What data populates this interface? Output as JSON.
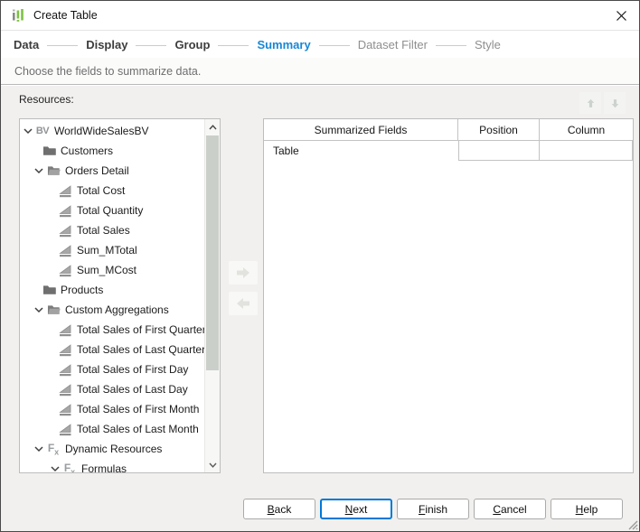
{
  "window": {
    "title": "Create Table",
    "close_glyph": "×",
    "app_icon": "bar-chart-icon"
  },
  "steps": [
    {
      "label": "Data",
      "state": "done"
    },
    {
      "label": "Display",
      "state": "done"
    },
    {
      "label": "Group",
      "state": "done"
    },
    {
      "label": "Summary",
      "state": "active"
    },
    {
      "label": "Dataset Filter",
      "state": "todo"
    },
    {
      "label": "Style",
      "state": "todo"
    }
  ],
  "instruction": "Choose the fields to summarize data.",
  "resources": {
    "label": "Resources:",
    "tree": [
      {
        "label": "WorldWideSalesBV",
        "icon": "business-view-icon",
        "level": 0,
        "expanded": true
      },
      {
        "label": "Customers",
        "icon": "folder-icon",
        "level": 1
      },
      {
        "label": "Orders Detail",
        "icon": "folder-open-icon",
        "level": 1,
        "expanded": true
      },
      {
        "label": "Total Cost",
        "icon": "summary-field-icon",
        "level": 2
      },
      {
        "label": "Total Quantity",
        "icon": "summary-field-icon",
        "level": 2
      },
      {
        "label": "Total Sales",
        "icon": "summary-field-icon",
        "level": 2
      },
      {
        "label": "Sum_MTotal",
        "icon": "summary-field-icon",
        "level": 2
      },
      {
        "label": "Sum_MCost",
        "icon": "summary-field-icon",
        "level": 2
      },
      {
        "label": "Products",
        "icon": "folder-icon",
        "level": 1
      },
      {
        "label": "Custom Aggregations",
        "icon": "folder-open-icon",
        "level": 1,
        "expanded": true
      },
      {
        "label": "Total Sales of First Quarter",
        "icon": "summary-field-icon",
        "level": 2
      },
      {
        "label": "Total Sales of Last Quarter",
        "icon": "summary-field-icon",
        "level": 2
      },
      {
        "label": "Total Sales of First Day",
        "icon": "summary-field-icon",
        "level": 2
      },
      {
        "label": "Total Sales of Last Day",
        "icon": "summary-field-icon",
        "level": 2
      },
      {
        "label": "Total Sales of First Month",
        "icon": "summary-field-icon",
        "level": 2
      },
      {
        "label": "Total Sales of Last Month",
        "icon": "summary-field-icon",
        "level": 2
      },
      {
        "label": "Dynamic Resources",
        "icon": "fx-icon",
        "level": 1,
        "expanded": true
      },
      {
        "label": "Formulas",
        "icon": "fx-icon",
        "level": 2,
        "expanded": true
      }
    ]
  },
  "transfer": {
    "right": "add-arrow-icon",
    "left": "remove-arrow-icon",
    "enabled": false
  },
  "reorder": {
    "up": "move-up-icon",
    "down": "move-down-icon",
    "enabled": false
  },
  "summary_table": {
    "columns": [
      "Summarized Fields",
      "Position",
      "Column"
    ],
    "rows": [
      {
        "field": "Table",
        "position": "",
        "column": ""
      }
    ]
  },
  "buttons": [
    {
      "label": "Back"
    },
    {
      "label": "Next",
      "default": true
    },
    {
      "label": "Finish"
    },
    {
      "label": "Cancel"
    },
    {
      "label": "Help"
    }
  ],
  "colors": {
    "accent_blue": "#1787d7",
    "default_button_border": "#0078d7",
    "icon_green": "#7dc142",
    "icon_gray": "#8f8f8f",
    "content_bg": "#f1f0ee"
  }
}
